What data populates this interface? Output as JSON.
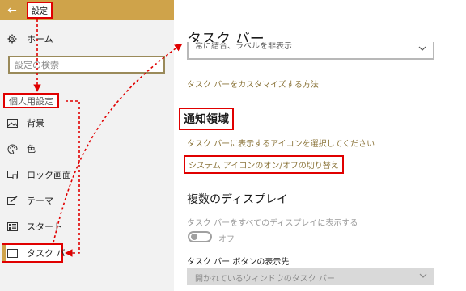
{
  "window": {
    "back_glyph": "←",
    "title": "設定"
  },
  "sidebar": {
    "home_label": "ホーム",
    "search_placeholder": "設定の検索",
    "section_header": "個人用設定",
    "items": [
      {
        "label": "背景",
        "icon": "picture-icon"
      },
      {
        "label": "色",
        "icon": "palette-icon"
      },
      {
        "label": "ロック画面",
        "icon": "lock-screen-icon"
      },
      {
        "label": "テーマ",
        "icon": "brush-icon"
      },
      {
        "label": "スタート",
        "icon": "start-icon"
      },
      {
        "label": "タスク バー",
        "icon": "taskbar-icon",
        "selected": true
      }
    ]
  },
  "main": {
    "page_title": "タスク バー",
    "top_dropdown_value": "常に結合、ラベルを非表示",
    "customize_link": "タスク バーをカスタマイズする方法",
    "notify_heading": "通知領域",
    "select_icons_link": "タスク バーに表示するアイコンを選択してください",
    "system_icons_link": "システム アイコンのオン/オフの切り替え",
    "multi_display_heading": "複数のディスプレイ",
    "show_all_displays_label": "タスク バーをすべてのディスプレイに表示する",
    "toggle_state_label": "オフ",
    "buttons_on_label": "タスク バー ボタンの表示先",
    "bottom_dropdown_value": "開かれているウィンドウのタスク バー"
  },
  "colors": {
    "accent": "#cfa34a",
    "link": "#8a7338",
    "annotation_red": "#e00000"
  }
}
